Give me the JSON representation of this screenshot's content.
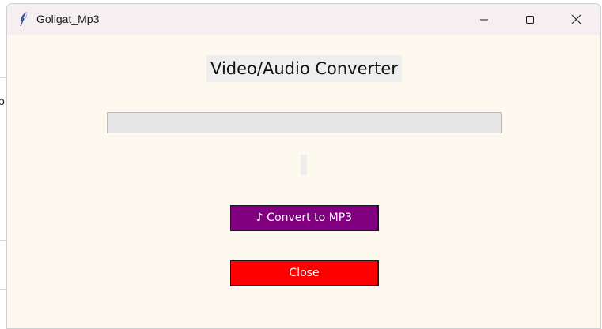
{
  "background": {
    "glyph": "o"
  },
  "window": {
    "title": "Goligat_Mp3",
    "icon": "feather-icon",
    "controls": {
      "minimize_icon": "minimize-icon",
      "maximize_icon": "maximize-icon",
      "close_icon": "close-icon"
    }
  },
  "main": {
    "heading": "Video/Audio Converter",
    "progress": {
      "value": 0
    },
    "status_text": "",
    "convert_button": {
      "label": "♪ Convert to MP3",
      "color": "#800080"
    },
    "close_button": {
      "label": "Close",
      "color": "#ff0000"
    }
  },
  "colors": {
    "window_bg": "#fdf9ef",
    "titlebar_bg": "#f5eff1",
    "progress_track": "#e6e6e6"
  }
}
